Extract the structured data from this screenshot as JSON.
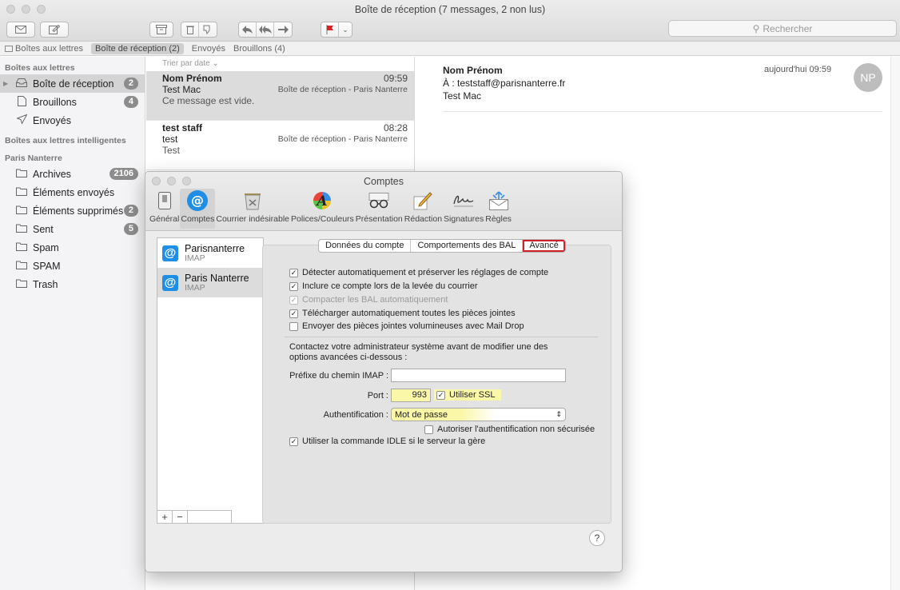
{
  "window": {
    "title": "Boîte de réception (7 messages, 2 non lus)"
  },
  "search": {
    "placeholder": "Rechercher"
  },
  "favorites": {
    "mailboxes": "Boîtes aux lettres",
    "inbox": "Boîte de réception (2)",
    "sent": "Envoyés",
    "drafts": "Brouillons (4)"
  },
  "sidebar": {
    "section_mailboxes": "Boîtes aux lettres",
    "inbox": {
      "label": "Boîte de réception",
      "count": "2"
    },
    "drafts": {
      "label": "Brouillons",
      "count": "4"
    },
    "sent": {
      "label": "Envoyés"
    },
    "section_smart": "Boîtes aux lettres intelligentes",
    "section_account": "Paris Nanterre",
    "account_items": [
      {
        "label": "Archives",
        "count": "2106"
      },
      {
        "label": "Éléments envoyés"
      },
      {
        "label": "Éléments supprimés",
        "count": "2"
      },
      {
        "label": "Sent",
        "count": "5"
      },
      {
        "label": "Spam"
      },
      {
        "label": "SPAM"
      },
      {
        "label": "Trash"
      }
    ]
  },
  "list": {
    "sort": "Trier par date ⌄",
    "messages": [
      {
        "from": "Nom Prénom",
        "time": "09:59",
        "subject": "Test Mac",
        "mailbox": "Boîte de réception - Paris Nanterre",
        "preview": "Ce message est vide."
      },
      {
        "from": "test staff",
        "time": "08:28",
        "subject": "test",
        "mailbox": "Boîte de réception - Paris Nanterre",
        "preview": "Test"
      }
    ]
  },
  "preview": {
    "from": "Nom Prénom",
    "to": "À :  teststaff@parisnanterre.fr",
    "subject": "Test Mac",
    "date": "aujourd'hui 09:59",
    "avatar": "NP"
  },
  "dialog": {
    "title": "Comptes",
    "tabs": [
      "Général",
      "Comptes",
      "Courrier indésirable",
      "Polices/Couleurs",
      "Présentation",
      "Rédaction",
      "Signatures",
      "Règles"
    ],
    "accounts": [
      {
        "name": "Parisnanterre",
        "type": "IMAP"
      },
      {
        "name": "Paris Nanterre",
        "type": "IMAP"
      }
    ],
    "segments": [
      "Données du compte",
      "Comportements des BAL",
      "Avancé"
    ],
    "checks": [
      {
        "label": "Détecter automatiquement et préserver les réglages de compte",
        "checked": true
      },
      {
        "label": "Inclure ce compte lors de la levée du courrier",
        "checked": true
      },
      {
        "label": "Compacter les BAL automatiquement",
        "checked": true
      },
      {
        "label": "Télécharger automatiquement toutes les pièces jointes",
        "checked": true
      },
      {
        "label": "Envoyer des pièces jointes volumineuses avec Mail Drop",
        "checked": false
      }
    ],
    "note": "Contactez votre administrateur système avant de modifier une des options avancées ci-dessous :",
    "imap_prefix_label": "Préfixe du chemin IMAP :",
    "imap_prefix_value": "",
    "port_label": "Port :",
    "port_value": "993",
    "ssl_label": "Utiliser SSL",
    "auth_label": "Authentification :",
    "auth_value": "Mot de passe",
    "insecure_label": "Autoriser l'authentification non sécurisée",
    "idle_label": "Utiliser la commande IDLE si le serveur la gère",
    "plus": "+",
    "minus": "−",
    "help": "?"
  }
}
